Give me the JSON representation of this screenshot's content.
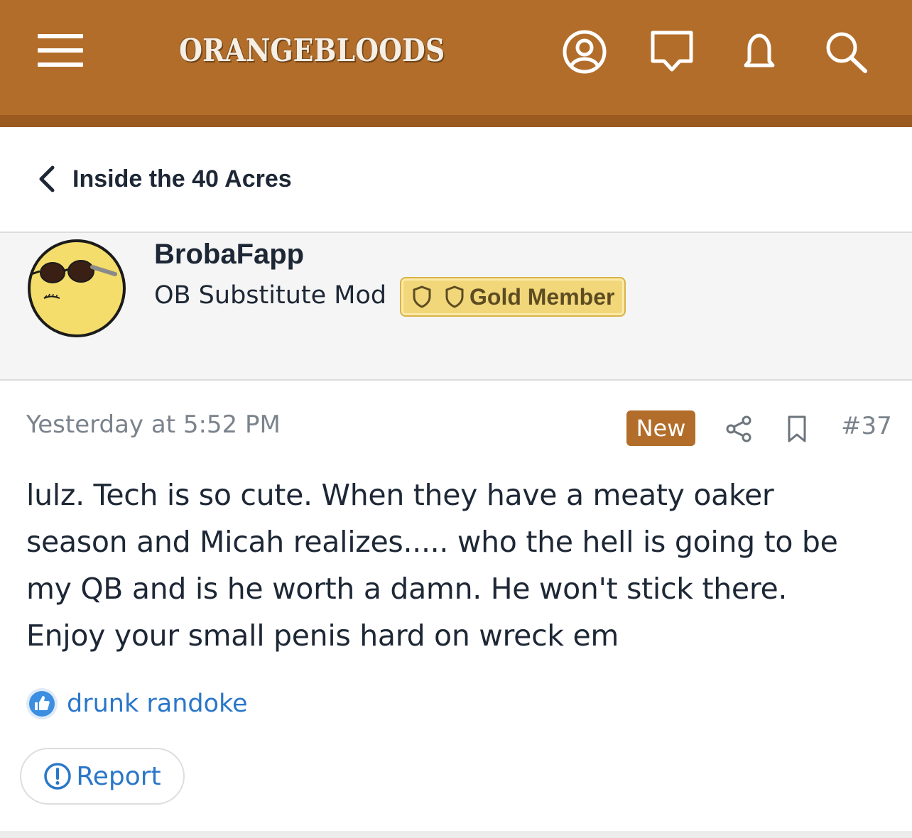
{
  "header": {
    "logo_text": "ORANGEBLOODS",
    "icons": [
      "menu-icon",
      "account-icon",
      "messages-icon",
      "alerts-icon",
      "search-icon"
    ],
    "bar_color": "#b26d2a"
  },
  "breadcrumb": {
    "label": "Inside the 40 Acres"
  },
  "post": {
    "author": {
      "username": "BrobaFapp",
      "title": "OB Substitute Mod",
      "badge": "Gold Member"
    },
    "timestamp": "Yesterday at 5:52 PM",
    "new_label": "New",
    "post_number": "#37",
    "body_lines": [
      "lulz. Tech is so cute. When they have a meaty oaker",
      "season and Micah realizes..... who the hell is going to be",
      "my QB and is he worth a damn. He won't stick there.",
      "Enjoy your small penis hard on wreck em"
    ],
    "reaction": {
      "icon": "like-icon",
      "user": "drunk randoke"
    },
    "report_label": "Report"
  },
  "colors": {
    "brand": "#b26d2a",
    "link": "#2a77c9",
    "gold": "#f2d77a",
    "muted": "#7b838c"
  }
}
